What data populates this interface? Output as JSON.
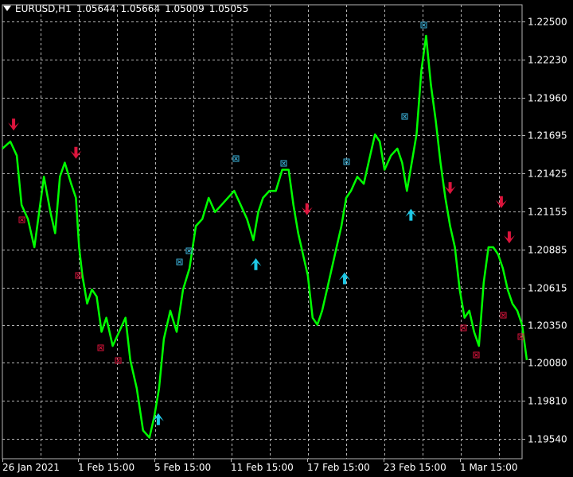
{
  "header": {
    "symbol": "EURUSD,H1",
    "open": "1.05644",
    "high": "1.05664",
    "low": "1.05009",
    "close": "1.05055"
  },
  "chart_data": {
    "type": "line",
    "ylim": [
      1.194,
      1.2262
    ],
    "y_ticks": [
      "1.22500",
      "1.22230",
      "1.21960",
      "1.21695",
      "1.21425",
      "1.21155",
      "1.20885",
      "1.20615",
      "1.20350",
      "1.20080",
      "1.19810",
      "1.19540"
    ],
    "x_ticks": [
      "26 Jan 2021",
      "1 Feb 15:00",
      "5 Feb 15:00",
      "11 Feb 15:00",
      "17 Feb 15:00",
      "23 Feb 15:00",
      "1 Mar 15:00"
    ],
    "grid": true,
    "n_bars": 650,
    "series": [
      {
        "color": "#00ff00",
        "points": [
          [
            0,
            1.216
          ],
          [
            10,
            1.2165
          ],
          [
            18,
            1.2155
          ],
          [
            24,
            1.212
          ],
          [
            32,
            1.211
          ],
          [
            40,
            1.209
          ],
          [
            46,
            1.2115
          ],
          [
            52,
            1.214
          ],
          [
            60,
            1.2115
          ],
          [
            66,
            1.21
          ],
          [
            72,
            1.214
          ],
          [
            78,
            1.215
          ],
          [
            86,
            1.2135
          ],
          [
            92,
            1.2125
          ],
          [
            96,
            1.209
          ],
          [
            100,
            1.207
          ],
          [
            106,
            1.205
          ],
          [
            112,
            1.206
          ],
          [
            118,
            1.2055
          ],
          [
            124,
            1.203
          ],
          [
            130,
            1.204
          ],
          [
            138,
            1.202
          ],
          [
            146,
            1.203
          ],
          [
            154,
            1.204
          ],
          [
            160,
            1.201
          ],
          [
            168,
            1.199
          ],
          [
            176,
            1.196
          ],
          [
            184,
            1.1955
          ],
          [
            190,
            1.197
          ],
          [
            196,
            1.199
          ],
          [
            202,
            1.2025
          ],
          [
            210,
            1.2045
          ],
          [
            218,
            1.203
          ],
          [
            226,
            1.206
          ],
          [
            234,
            1.2075
          ],
          [
            242,
            1.2105
          ],
          [
            250,
            1.211
          ],
          [
            258,
            1.2125
          ],
          [
            266,
            1.2115
          ],
          [
            274,
            1.212
          ],
          [
            282,
            1.2125
          ],
          [
            290,
            1.213
          ],
          [
            298,
            1.212
          ],
          [
            306,
            1.211
          ],
          [
            314,
            1.2095
          ],
          [
            320,
            1.2115
          ],
          [
            326,
            1.2125
          ],
          [
            334,
            1.213
          ],
          [
            342,
            1.213
          ],
          [
            350,
            1.2145
          ],
          [
            358,
            1.2145
          ],
          [
            364,
            1.212
          ],
          [
            370,
            1.21
          ],
          [
            376,
            1.2085
          ],
          [
            382,
            1.207
          ],
          [
            388,
            1.204
          ],
          [
            394,
            1.2035
          ],
          [
            400,
            1.2045
          ],
          [
            406,
            1.206
          ],
          [
            412,
            1.2075
          ],
          [
            418,
            1.209
          ],
          [
            424,
            1.2105
          ],
          [
            430,
            1.2125
          ],
          [
            436,
            1.213
          ],
          [
            444,
            1.214
          ],
          [
            452,
            1.2135
          ],
          [
            460,
            1.2155
          ],
          [
            466,
            1.217
          ],
          [
            472,
            1.2165
          ],
          [
            478,
            1.2145
          ],
          [
            486,
            1.2155
          ],
          [
            494,
            1.216
          ],
          [
            500,
            1.215
          ],
          [
            506,
            1.213
          ],
          [
            512,
            1.215
          ],
          [
            518,
            1.217
          ],
          [
            524,
            1.2215
          ],
          [
            530,
            1.224
          ],
          [
            536,
            1.2205
          ],
          [
            542,
            1.218
          ],
          [
            548,
            1.215
          ],
          [
            554,
            1.2125
          ],
          [
            560,
            1.2105
          ],
          [
            566,
            1.209
          ],
          [
            572,
            1.206
          ],
          [
            578,
            1.204
          ],
          [
            584,
            1.2045
          ],
          [
            590,
            1.203
          ],
          [
            596,
            1.202
          ],
          [
            602,
            1.2065
          ],
          [
            608,
            1.209
          ],
          [
            614,
            1.209
          ],
          [
            620,
            1.2085
          ],
          [
            626,
            1.2075
          ],
          [
            632,
            1.206
          ],
          [
            638,
            1.205
          ],
          [
            644,
            1.2045
          ],
          [
            650,
            1.2035
          ],
          [
            656,
            1.201
          ]
        ]
      }
    ],
    "sell_arrows": [
      [
        14,
        1.2175
      ],
      [
        92,
        1.2155
      ],
      [
        381,
        1.2115
      ],
      [
        560,
        1.213
      ],
      [
        624,
        1.212
      ],
      [
        634,
        1.2095
      ]
    ],
    "buy_arrows": [
      [
        195,
        1.197
      ],
      [
        317,
        1.208
      ],
      [
        428,
        1.207
      ],
      [
        511,
        1.2115
      ]
    ],
    "buy_markers": [
      [
        221,
        1.208
      ],
      [
        233,
        1.2088
      ],
      [
        292,
        1.2153
      ],
      [
        351,
        1.215
      ],
      [
        430,
        1.2151
      ],
      [
        503,
        1.2183
      ],
      [
        527,
        1.2248
      ]
    ],
    "sell_markers": [
      [
        24,
        1.211
      ],
      [
        95,
        1.207
      ],
      [
        122,
        1.2019
      ],
      [
        144,
        1.201
      ],
      [
        576,
        1.2033
      ],
      [
        592,
        1.2014
      ],
      [
        626,
        1.2042
      ],
      [
        648,
        1.2027
      ]
    ]
  },
  "colors": {
    "background": "#000000",
    "grid": "#b4b4b4",
    "price": "#00ff00",
    "sell_arrow": "#dc143c",
    "buy_arrow": "#1ec8e6",
    "sell_marker": "#dc143c",
    "buy_marker": "#3cb4dc"
  }
}
